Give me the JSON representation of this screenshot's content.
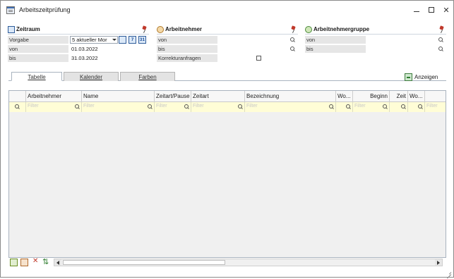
{
  "window": {
    "title": "Arbeitszeitprüfung"
  },
  "zeitraum": {
    "title": "Zeitraum",
    "vorgabe_label": "Vorgabe",
    "vorgabe_value": "5  aktueller Mor",
    "von_label": "von",
    "von_value": "01.03.2022",
    "bis_label": "bis",
    "bis_value": "31.03.2022",
    "week_icon_text": "7",
    "month_icon_text": "31"
  },
  "arbeitnehmer": {
    "title": "Arbeitnehmer",
    "von_label": "von",
    "bis_label": "bis",
    "korrektur_label": "Korrekturanfragen"
  },
  "gruppe": {
    "title": "Arbeitnehmergruppe",
    "von_label": "von",
    "bis_label": "bis"
  },
  "tabs": [
    {
      "label": "Tabelle"
    },
    {
      "label": "Kalender"
    },
    {
      "label": "Farben"
    }
  ],
  "anzeigen_label": "Anzeigen",
  "grid": {
    "columns": [
      "Arbeitnehmer",
      "Name",
      "Zeitart/Pause",
      "Zeitart",
      "Bezeichnung",
      "Wo...",
      "Beginn",
      "Zeit",
      "Wo..."
    ],
    "filter_placeholder": "Filter"
  }
}
